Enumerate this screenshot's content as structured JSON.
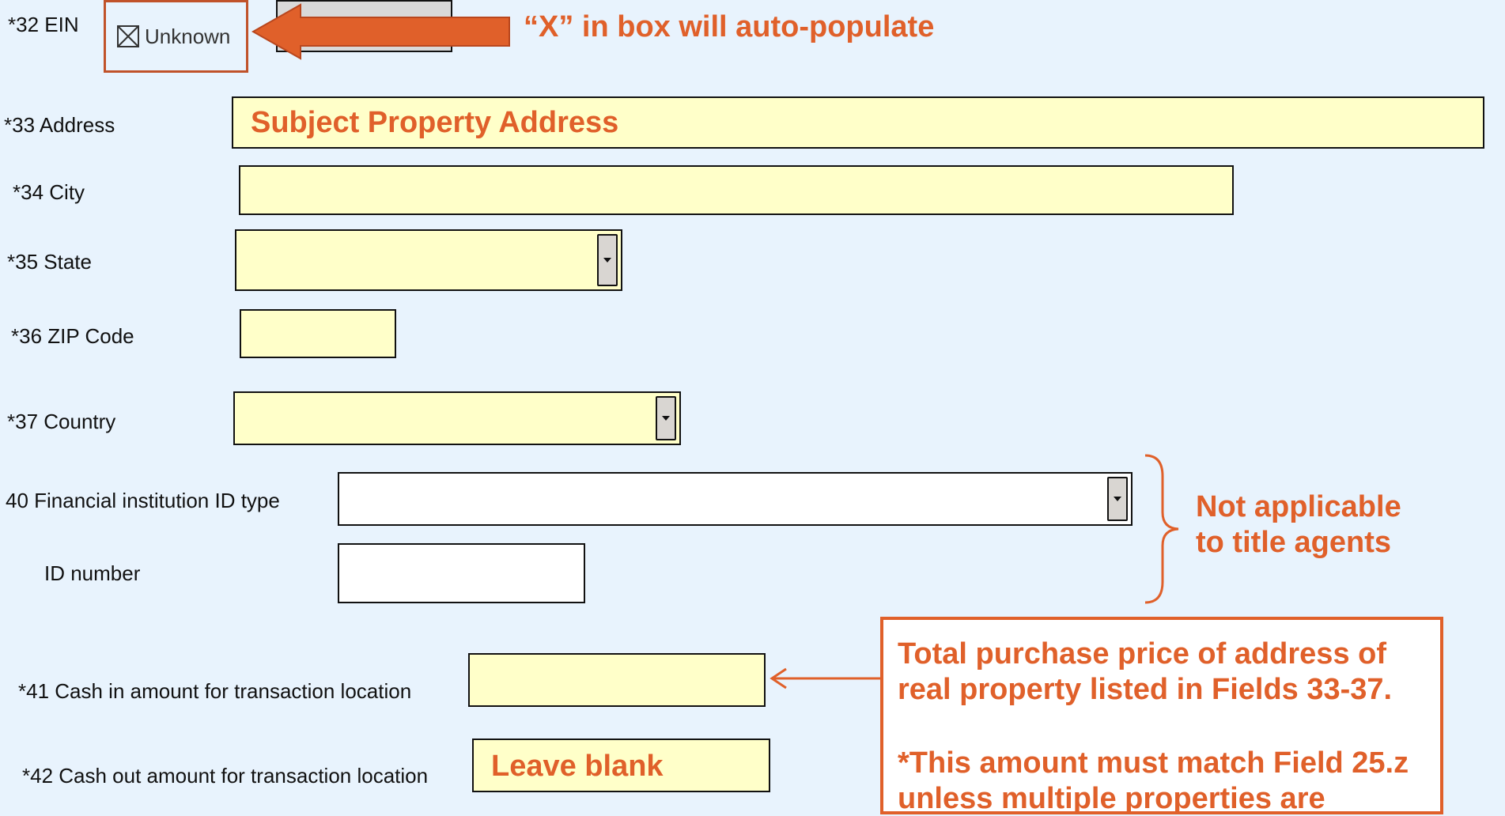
{
  "fields": {
    "ein": {
      "label": "*32  EIN",
      "checkbox_label": "Unknown",
      "checked": true
    },
    "address": {
      "label": "*33  Address",
      "value": "Subject Property Address"
    },
    "city": {
      "label": "*34  City",
      "value": ""
    },
    "state": {
      "label": "*35  State",
      "value": ""
    },
    "zip": {
      "label": "*36  ZIP Code",
      "value": ""
    },
    "country": {
      "label": "*37  Country",
      "value": ""
    },
    "fin_id_type": {
      "label": "40  Financial institution ID type",
      "value": ""
    },
    "id_number": {
      "label": "ID number",
      "value": ""
    },
    "cash_in": {
      "label": "*41 Cash in amount for transaction location",
      "value": ""
    },
    "cash_out": {
      "label": "*42 Cash out amount for transaction location",
      "value": "Leave blank"
    }
  },
  "annotations": {
    "auto_populate": "“X” in box will auto-populate",
    "not_applicable_line1": "Not applicable",
    "not_applicable_line2": "to title agents",
    "callout_line1": "Total purchase price of  address of",
    "callout_line2": "real property listed in Fields 33-37.",
    "callout_line3": "*This amount must match Field 25.z",
    "callout_line4": "unless multiple properties are"
  },
  "colors": {
    "background": "#e8f3fd",
    "field_yellow": "#ffffc9",
    "annotation_orange": "#e0602a",
    "arrow_fill": "#e0602a"
  },
  "icons": {
    "checkbox": "checked-box-icon",
    "dropdown": "chevron-down-icon",
    "arrow": "left-arrow-icon",
    "brace": "right-curly-brace-icon"
  }
}
